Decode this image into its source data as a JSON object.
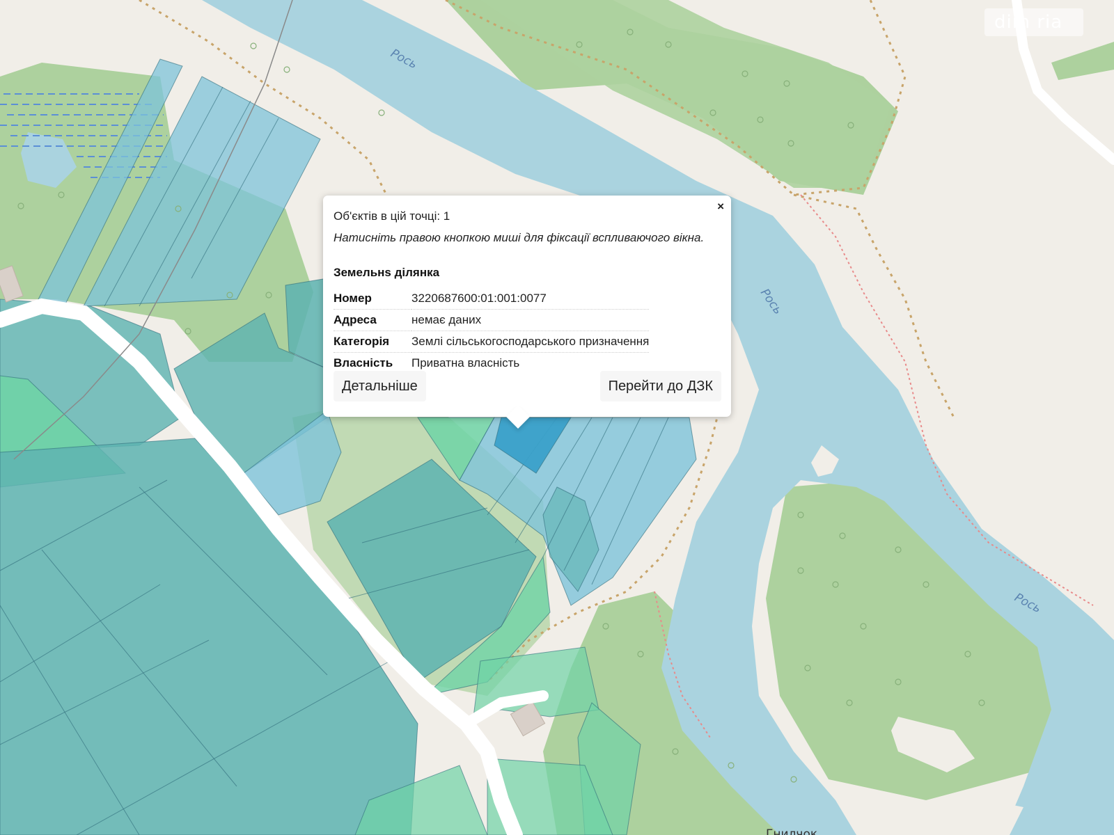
{
  "map": {
    "river_labels": [
      "Рось",
      "Рось",
      "Рось"
    ],
    "village_label": "Гнилчок",
    "colors": {
      "background": "#f1eee8",
      "water": "#aad3df",
      "forest": "#add19e",
      "parcel_blue": "#7ec3d9",
      "parcel_teal": "#5db3b0",
      "parcel_green": "#6fd3a6",
      "parcel_selected": "#3aa0c9",
      "path": "#c8a46a",
      "boundary": "#e88a8a"
    }
  },
  "watermark": {
    "text": "dim ria"
  },
  "popup": {
    "close_label": "×",
    "count_text": "Об'єктів в цій точці: 1",
    "hint_text": "Натисніть правою кнопкою миші для фіксації вспливаючого вікна.",
    "section_title": "Земельнs ділянка",
    "rows": [
      {
        "key": "Номер",
        "value": "3220687600:01:001:0077"
      },
      {
        "key": "Адреса",
        "value": "немає даних"
      },
      {
        "key": "Категорія",
        "value": "Землі сільськогосподарського призначення"
      },
      {
        "key": "Власність",
        "value": "Приватна власність"
      }
    ],
    "details_button": "Детальніше",
    "dzk_button": "Перейти до ДЗК"
  }
}
